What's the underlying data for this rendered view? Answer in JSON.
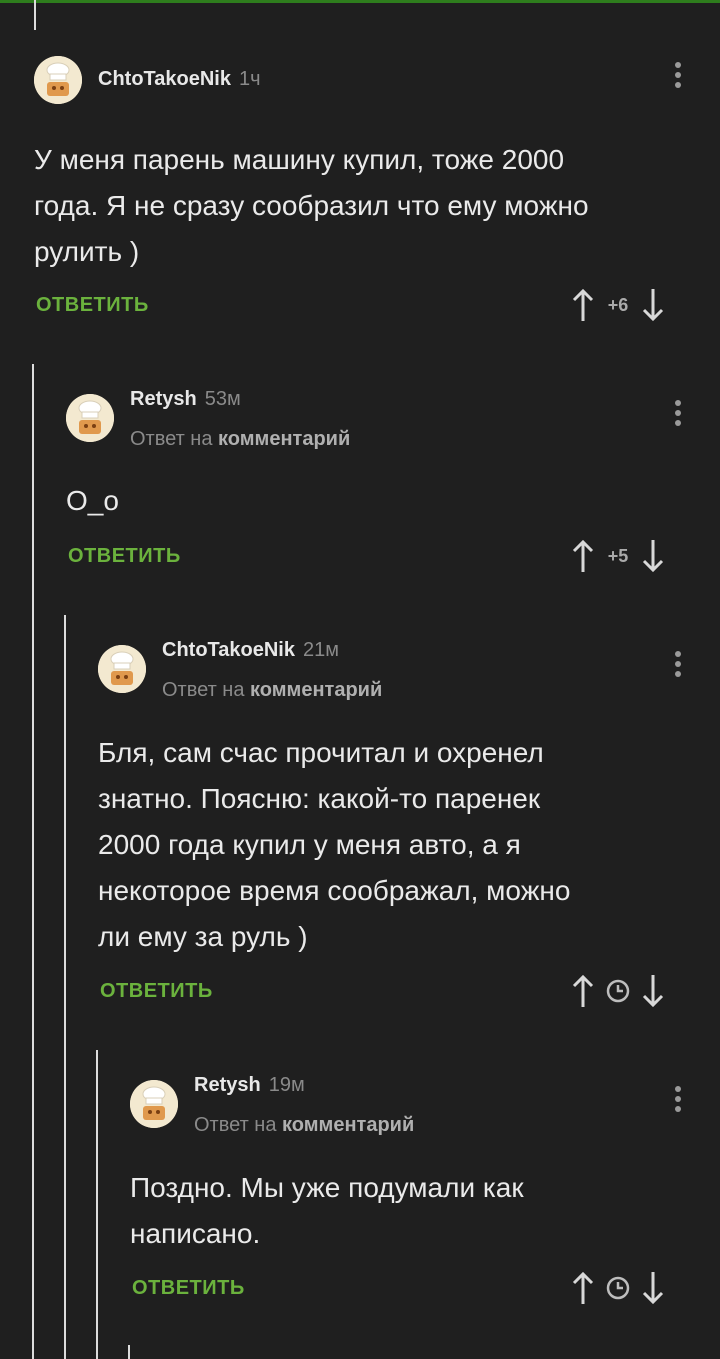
{
  "comments": [
    {
      "author": "ChtoTakoeNik",
      "time": "1ч",
      "reply_prefix": "",
      "reply_target": "",
      "text_lines": [
        "У меня парень машину купил, тоже 2000",
        "года. Я не сразу сообразил что ему можно",
        "рулить )"
      ],
      "reply_label": "ОТВЕТИТЬ",
      "score": "+6"
    },
    {
      "author": "Retysh",
      "time": "53м",
      "reply_prefix": "Ответ на",
      "reply_target": "комментарий",
      "text_lines": [
        "О_о"
      ],
      "reply_label": "ОТВЕТИТЬ",
      "score": "+5"
    },
    {
      "author": "ChtoTakoeNik",
      "time": "21м",
      "reply_prefix": "Ответ на",
      "reply_target": "комментарий",
      "text_lines": [
        "Бля, сам счас прочитал и охренел",
        "знатно. Поясню: какой-то паренек",
        "2000 года купил у меня авто, а я",
        "некоторое время соображал, можно",
        "ли ему за руль )"
      ],
      "reply_label": "ОТВЕТИТЬ",
      "score_icon": "clock-icon"
    },
    {
      "author": "Retysh",
      "time": "19м",
      "reply_prefix": "Ответ на",
      "reply_target": "комментарий",
      "text_lines": [
        "Поздно. Мы уже подумали как",
        "написано."
      ],
      "reply_label": "ОТВЕТИТЬ",
      "score_icon": "clock-icon"
    }
  ],
  "icons": {
    "avatar": "chef-avatar-icon",
    "menu": "more-vertical-icon",
    "upvote": "arrow-up-icon",
    "downvote": "arrow-down-icon"
  },
  "colors": {
    "background": "#1f1f1f",
    "accent": "#6bb23d",
    "text": "#eaeaea",
    "muted": "#8a8a8a"
  }
}
